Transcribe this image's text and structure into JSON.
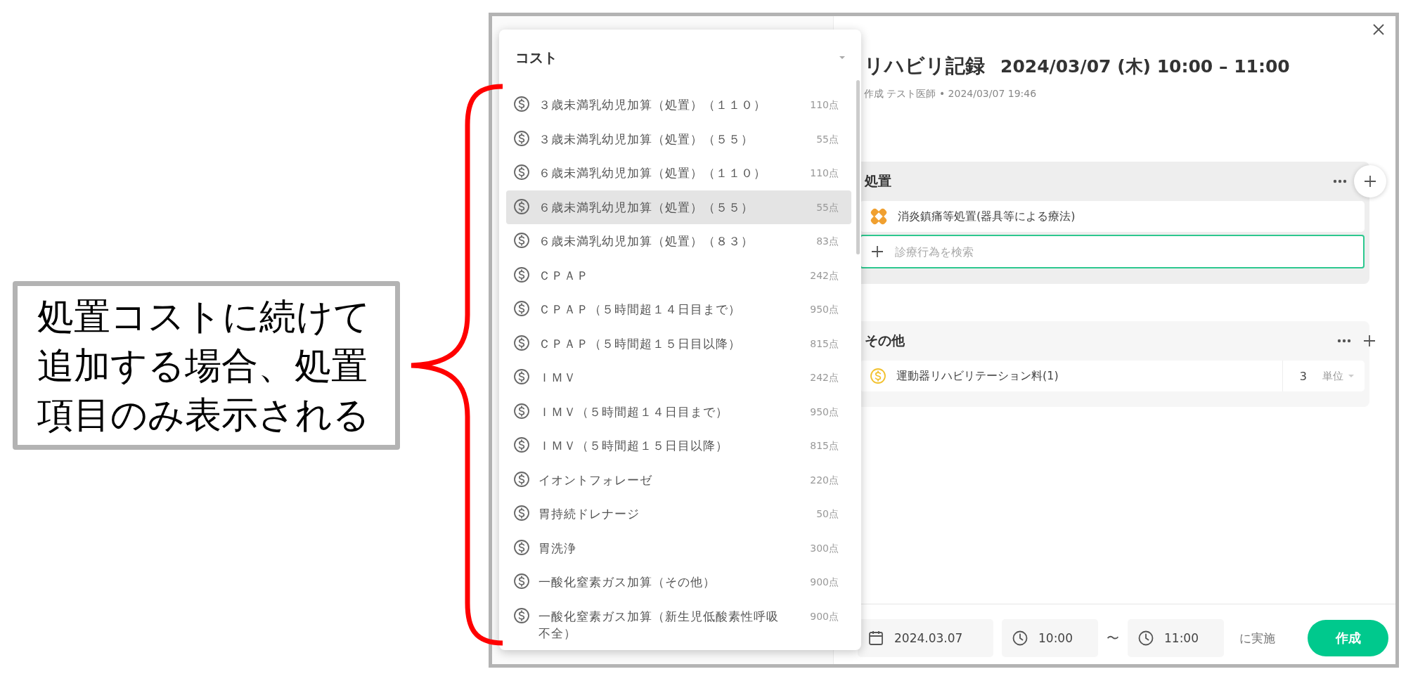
{
  "annotation": {
    "text": "処置コストに続けて追加する場合、処置項目のみ表示される"
  },
  "dropdown": {
    "title": "コスト",
    "items": [
      {
        "name": "３歳未満乳幼児加算（処置）（１１０）",
        "points": "110点",
        "selected": false
      },
      {
        "name": "３歳未満乳幼児加算（処置）（５５）",
        "points": "55点",
        "selected": false
      },
      {
        "name": "６歳未満乳幼児加算（処置）（１１０）",
        "points": "110点",
        "selected": false
      },
      {
        "name": "６歳未満乳幼児加算（処置）（５５）",
        "points": "55点",
        "selected": true
      },
      {
        "name": "６歳未満乳幼児加算（処置）（８３）",
        "points": "83点",
        "selected": false
      },
      {
        "name": "ＣＰＡＰ",
        "points": "242点",
        "selected": false
      },
      {
        "name": "ＣＰＡＰ（５時間超１４日目まで）",
        "points": "950点",
        "selected": false
      },
      {
        "name": "ＣＰＡＰ（５時間超１５日目以降）",
        "points": "815点",
        "selected": false
      },
      {
        "name": "ＩＭＶ",
        "points": "242点",
        "selected": false
      },
      {
        "name": "ＩＭＶ（５時間超１４日目まで）",
        "points": "950点",
        "selected": false
      },
      {
        "name": "ＩＭＶ（５時間超１５日目以降）",
        "points": "815点",
        "selected": false
      },
      {
        "name": "イオントフォレーゼ",
        "points": "220点",
        "selected": false
      },
      {
        "name": "胃持続ドレナージ",
        "points": "50点",
        "selected": false
      },
      {
        "name": "胃洗浄",
        "points": "300点",
        "selected": false
      },
      {
        "name": "一酸化窒素ガス加算（その他）",
        "points": "900点",
        "selected": false
      },
      {
        "name": "一酸化窒素ガス加算（新生児低酸素性呼吸不全）",
        "points": "900点",
        "selected": false
      }
    ]
  },
  "record": {
    "title": "リハビリ記録",
    "datetime": "2024/03/07 (木) 10:00 – 11:00",
    "meta": "作成 テスト医師 • 2024/03/07 19:46"
  },
  "sections": [
    {
      "title": "処置",
      "highlighted": true,
      "items": [
        {
          "kind": "procedure",
          "name": "消炎鎮痛等処置(器具等による療法)"
        }
      ],
      "search": {
        "placeholder": "診療行為を検索"
      }
    },
    {
      "title": "その他",
      "highlighted": false,
      "items": [
        {
          "kind": "cost",
          "name": "運動器リハビリテーション料(1)",
          "quantity": "3",
          "unit": "単位"
        }
      ]
    }
  ],
  "footer": {
    "date": "2024.03.07",
    "start": "10:00",
    "separator": "〜",
    "end": "11:00",
    "suffix": "に実施",
    "submit": "作成"
  }
}
